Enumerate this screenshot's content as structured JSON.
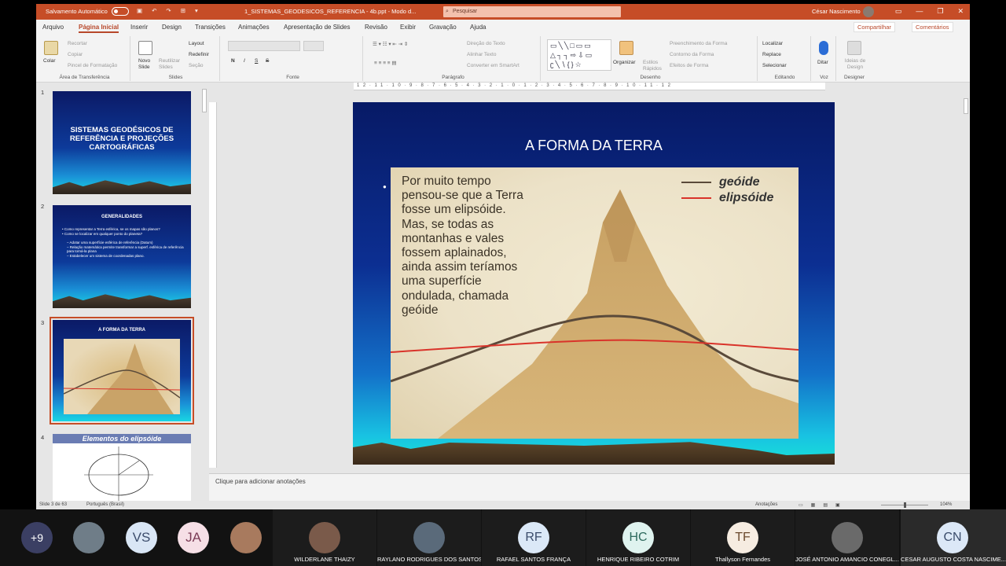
{
  "titlebar": {
    "autosave_label": "Salvamento Automático",
    "doc_title": "1_SISTEMAS_GEODESICOS_REFERENCIA - 4b.ppt  -  Modo d...",
    "search_placeholder": "Pesquisar",
    "user_name": "César Nascimento"
  },
  "tabs": [
    "Arquivo",
    "Página Inicial",
    "Inserir",
    "Design",
    "Transições",
    "Animações",
    "Apresentação de Slides",
    "Revisão",
    "Exibir",
    "Gravação",
    "Ajuda"
  ],
  "share": {
    "share_label": "Compartilhar",
    "comments_label": "Comentários"
  },
  "ribbon": {
    "clipboard": {
      "paste": "Colar",
      "cut": "Recortar",
      "copy": "Copiar",
      "format_painter": "Pincel de Formatação",
      "group": "Área de Transferência"
    },
    "slides": {
      "new_slide": "Novo Slide",
      "reuse": "Reutilizar Slides",
      "layout": "Layout",
      "reset": "Redefinir",
      "section": "Seção",
      "group": "Slides"
    },
    "font": {
      "bold": "N",
      "italic": "I",
      "underline": "S",
      "strike": "S",
      "group": "Fonte"
    },
    "paragraph": {
      "text_direction": "Direção do Texto",
      "align_text": "Alinhar Texto",
      "smartart": "Converter em SmartArt",
      "group": "Parágrafo"
    },
    "drawing": {
      "arrange": "Organizar",
      "quick_styles": "Estilos Rápidos",
      "fill": "Preenchimento da Forma",
      "outline": "Contorno da Forma",
      "effects": "Efeitos de Forma",
      "group": "Desenho"
    },
    "editing": {
      "find": "Localizar",
      "replace": "Replace",
      "select": "Selecionar",
      "group": "Editando"
    },
    "voice": {
      "dictate": "Ditar",
      "group": "Voz"
    },
    "designer": {
      "ideas": "Ideias de Design",
      "group": "Designer"
    }
  },
  "thumbnails": {
    "slide1": {
      "num": "1",
      "title": "SISTEMAS GEODÉSICOS DE REFERÊNCIA E PROJEÇÕES CARTOGRÁFICAS"
    },
    "slide2": {
      "num": "2",
      "title": "GENERALIDADES",
      "lines": [
        "•  Como representar a Terra esférica, se os mapas são planos?",
        "•  Como se localizar em qualquer ponto do planeta?",
        "–  Adotar uma superfície esférica de referência (Datum)",
        "–  Relação matemática permite transformar a superf. esférica de referência para torná-la plana",
        "–  Estabelecer um sistema de coordenadas plano."
      ]
    },
    "slide3": {
      "num": "3",
      "title": "A FORMA DA TERRA"
    },
    "slide4": {
      "num": "4",
      "title": "Elementos do elipsóide"
    }
  },
  "slide": {
    "title": "A FORMA DA TERRA",
    "body": "Por muito tempo\npensou-se que a Terra\nfosse um elipsóide.\nMas, se todas as\nmontanhas e vales\nfossem aplainados,\nainda assim teríamos\numa superfície\nondulada, chamada\ngeóide",
    "legend_geoid": "geóide",
    "legend_ellipsoid": "elipsóide",
    "geoid_color": "#5a4a3a",
    "ellipsoid_color": "#d9332a"
  },
  "notes_placeholder": "Clique para adicionar anotações",
  "status": {
    "slide_count": "Slide 3 de 63",
    "language": "Português (Brasil)",
    "notes": "Anotações",
    "zoom": "104%"
  },
  "participants": {
    "more": "+9",
    "initials": [
      "VS",
      "JA"
    ],
    "tiles": [
      {
        "name": "WILDERLANE THAIZY",
        "initials": ""
      },
      {
        "name": "RAYLANO RODRIGUES DOS SANTOS",
        "initials": ""
      },
      {
        "name": "RAFAEL SANTOS FRANÇA",
        "initials": "RF"
      },
      {
        "name": "HENRIQUE RIBEIRO COTRIM",
        "initials": "HC"
      },
      {
        "name": "Thallyson Fernandes",
        "initials": "TF"
      },
      {
        "name": "JOSÉ ANTONIO AMANCIO CONEGL...",
        "initials": ""
      },
      {
        "name": "CESAR AUGUSTO COSTA NASCIME...",
        "initials": "CN"
      }
    ]
  }
}
